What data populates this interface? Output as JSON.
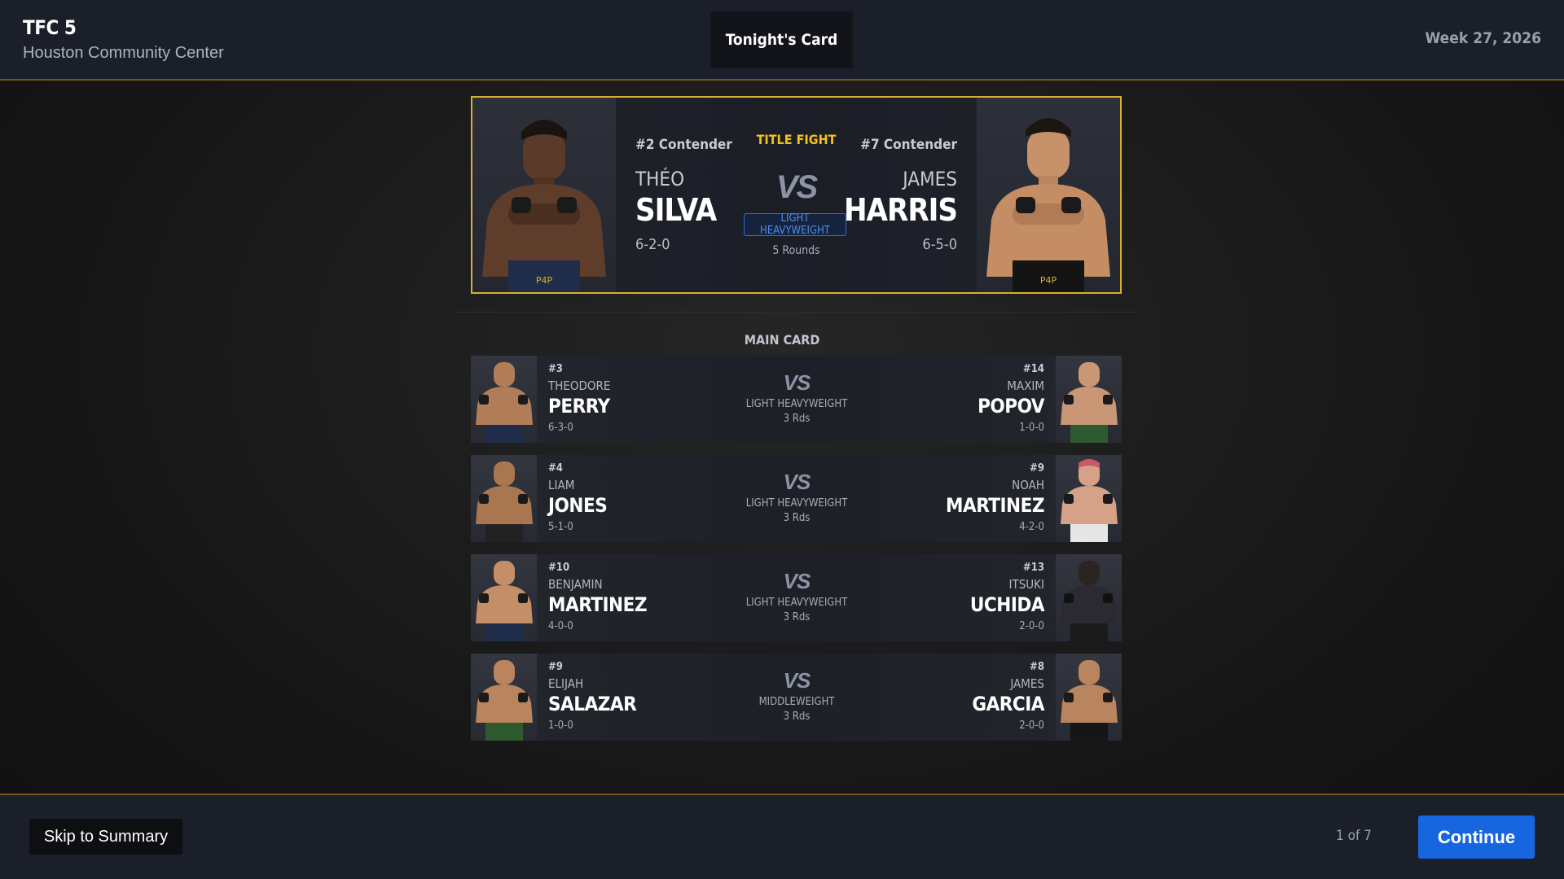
{
  "header": {
    "event_title": "TFC 5",
    "venue": "Houston Community Center",
    "tab_label": "Tonight's Card",
    "week": "Week 27, 2026"
  },
  "title_fight": {
    "label": "TITLE FIGHT",
    "vs": "VS",
    "weight_class": "LIGHT HEAVYWEIGHT",
    "rounds": "5 Rounds",
    "left": {
      "rank": "#2 Contender",
      "first": "THÉO",
      "last": "SILVA",
      "record": "6-2-0"
    },
    "right": {
      "rank": "#7 Contender",
      "first": "JAMES",
      "last": "HARRIS",
      "record": "6-5-0"
    }
  },
  "main_card": {
    "label": "MAIN CARD",
    "bouts": [
      {
        "vs": "VS",
        "weight_class": "LIGHT HEAVYWEIGHT",
        "rounds": "3 Rds",
        "left": {
          "rank": "#3",
          "first": "THEODORE",
          "last": "PERRY",
          "record": "6-3-0"
        },
        "right": {
          "rank": "#14",
          "first": "MAXIM",
          "last": "POPOV",
          "record": "1-0-0"
        }
      },
      {
        "vs": "VS",
        "weight_class": "LIGHT HEAVYWEIGHT",
        "rounds": "3 Rds",
        "left": {
          "rank": "#4",
          "first": "LIAM",
          "last": "JONES",
          "record": "5-1-0"
        },
        "right": {
          "rank": "#9",
          "first": "NOAH",
          "last": "MARTINEZ",
          "record": "4-2-0"
        }
      },
      {
        "vs": "VS",
        "weight_class": "LIGHT HEAVYWEIGHT",
        "rounds": "3 Rds",
        "left": {
          "rank": "#10",
          "first": "BENJAMIN",
          "last": "MARTINEZ",
          "record": "4-0-0"
        },
        "right": {
          "rank": "#13",
          "first": "ITSUKI",
          "last": "UCHIDA",
          "record": "2-0-0"
        }
      },
      {
        "vs": "VS",
        "weight_class": "MIDDLEWEIGHT",
        "rounds": "3 Rds",
        "left": {
          "rank": "#9",
          "first": "ELIJAH",
          "last": "SALAZAR",
          "record": "1-0-0"
        },
        "right": {
          "rank": "#8",
          "first": "JAMES",
          "last": "GARCIA",
          "record": "2-0-0"
        }
      }
    ]
  },
  "footer": {
    "skip_label": "Skip to Summary",
    "page_indicator": "1 of 7",
    "continue_label": "Continue"
  },
  "colors": {
    "accent_gold": "#d4b32a",
    "title_label": "#f3c21a",
    "primary_blue": "#1766e0"
  }
}
